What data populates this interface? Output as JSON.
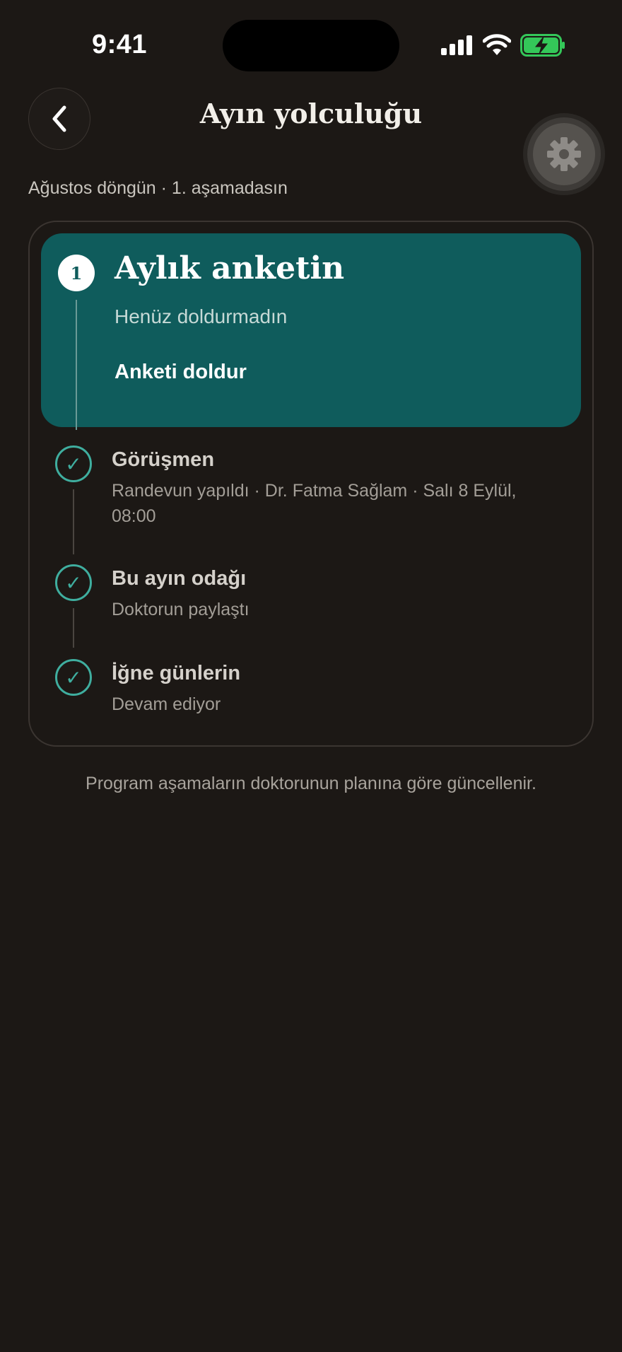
{
  "status_bar": {
    "time": "9:41",
    "signal_icon": "cellular-signal-icon",
    "wifi_icon": "wifi-icon",
    "battery_icon": "battery-charging-icon",
    "battery_color": "#34c759"
  },
  "header": {
    "title": "Ayın yolculuğu",
    "back_icon": "chevron-left-icon",
    "settings_icon": "gear-icon"
  },
  "subtitle": "Ağustos döngün · 1. aşamadasın",
  "steps": [
    {
      "number": "1",
      "title": "Aylık anketin",
      "subtitle": "Henüz doldurmadın",
      "action": "Anketi doldur",
      "state": "active"
    },
    {
      "title": "Görüşmen",
      "subtitle": "Randevun yapıldı · Dr. Fatma Sağlam · Salı 8 Eylül, 08:00",
      "state": "done"
    },
    {
      "title": "Bu ayın odağı",
      "subtitle": "Doktorun paylaştı",
      "state": "done"
    },
    {
      "title": "İğne günlerin",
      "subtitle": "Devam ediyor",
      "state": "done"
    }
  ],
  "footer_note": "Program aşamaların doktorunun planına göre güncellenir.",
  "colors": {
    "background": "#1c1815",
    "accent": "#0f5c5c",
    "check": "#3fae9f"
  }
}
